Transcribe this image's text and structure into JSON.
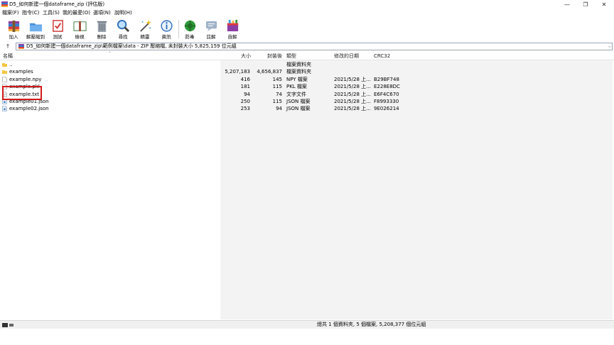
{
  "window": {
    "title": "D5_如何新建一個dataframe_zip (評估版)",
    "minimize": "—",
    "maximize": "❐",
    "close": "✕"
  },
  "menu": [
    "檔案(F)",
    "指令(C)",
    "工具(S)",
    "我的最愛(O)",
    "選項(N)",
    "說明(H)"
  ],
  "toolbar": [
    {
      "label": "加入",
      "icon": "add-archive-icon"
    },
    {
      "label": "解壓縮到",
      "icon": "extract-to-icon"
    },
    {
      "label": "測試",
      "icon": "test-icon"
    },
    {
      "label": "檢視",
      "icon": "view-icon"
    },
    {
      "label": "刪除",
      "icon": "delete-icon"
    },
    {
      "label": "尋找",
      "icon": "find-icon"
    },
    {
      "label": "精靈",
      "icon": "wizard-icon"
    },
    {
      "label": "資訊",
      "icon": "info-icon"
    },
    {
      "label": "防毒",
      "icon": "antivirus-icon"
    },
    {
      "label": "註解",
      "icon": "comment-icon"
    },
    {
      "label": "自解",
      "icon": "sfx-icon"
    }
  ],
  "address": {
    "path": "D5_如何新建一個dataframe_zip\\範例檔案\\data - ZIP 壓縮檔, 未封裝大小 5,825,159 位元組"
  },
  "columns": {
    "name": "名稱",
    "size": "大小",
    "packed": "封裝後",
    "type": "類型",
    "modified": "修改的日期",
    "crc": "CRC32"
  },
  "files": [
    {
      "name": "..",
      "size": "",
      "packed": "",
      "type": "檔案資料夾",
      "modified": "",
      "crc": "",
      "kind": "folder"
    },
    {
      "name": "examples",
      "size": "5,207,183",
      "packed": "4,656,837",
      "type": "檔案資料夾",
      "modified": "",
      "crc": "",
      "kind": "folder"
    },
    {
      "name": "example.npy",
      "size": "416",
      "packed": "145",
      "type": "NPY 檔案",
      "modified": "2021/5/28 上...",
      "crc": "B29BF748",
      "kind": "file"
    },
    {
      "name": "example.pkl",
      "size": "181",
      "packed": "115",
      "type": "PKL 檔案",
      "modified": "2021/5/28 上...",
      "crc": "E228E8DC",
      "kind": "file"
    },
    {
      "name": "example.txt",
      "size": "94",
      "packed": "74",
      "type": "文字文件",
      "modified": "2021/5/28 上...",
      "crc": "E6F4C670",
      "kind": "text"
    },
    {
      "name": "example01.json",
      "size": "250",
      "packed": "115",
      "type": "JSON 檔案",
      "modified": "2021/5/28 上...",
      "crc": "F8993330",
      "kind": "json"
    },
    {
      "name": "example02.json",
      "size": "253",
      "packed": "94",
      "type": "JSON 檔案",
      "modified": "2021/5/28 上...",
      "crc": "9E026214",
      "kind": "json"
    }
  ],
  "status": {
    "text": "總共 1 個資料夾, 5 個檔案, 5,208,377 個位元組"
  },
  "colors": {
    "highlight": "#d21a1a",
    "folder": "#f5c542",
    "accent": "#2f6fbd"
  }
}
